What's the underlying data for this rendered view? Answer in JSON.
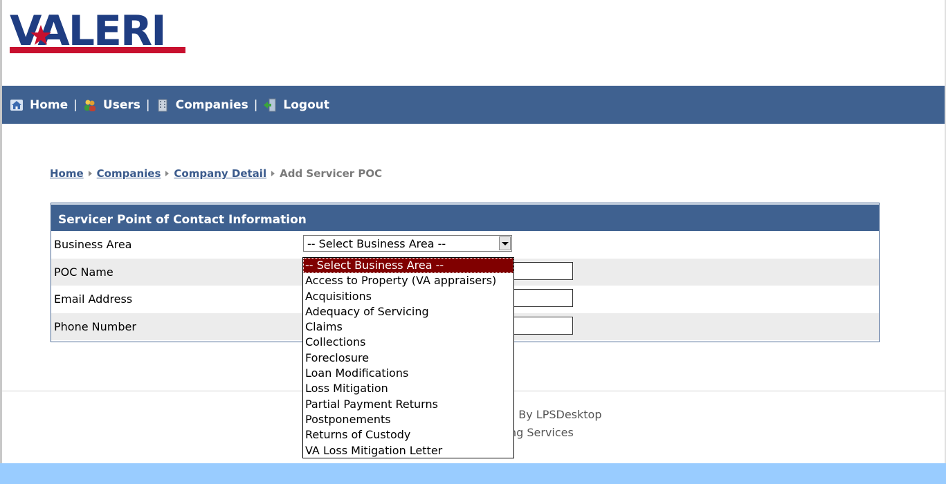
{
  "logo": {
    "text": "VALERI"
  },
  "nav": {
    "items": [
      {
        "label": "Home",
        "icon": "home-icon"
      },
      {
        "label": "Users",
        "icon": "users-icon"
      },
      {
        "label": "Companies",
        "icon": "building-icon"
      },
      {
        "label": "Logout",
        "icon": "logout-icon"
      }
    ],
    "separator": "|"
  },
  "breadcrumb": {
    "items": [
      "Home",
      "Companies",
      "Company Detail"
    ],
    "current": "Add Servicer POC"
  },
  "form": {
    "title": "Servicer Point of Contact Information",
    "fields": [
      {
        "label": "Business Area",
        "value": "-- Select Business Area --"
      },
      {
        "label": "POC Name",
        "value": ""
      },
      {
        "label": "Email Address",
        "value": ""
      },
      {
        "label": "Phone Number",
        "value": ""
      }
    ]
  },
  "dropdown": {
    "options": [
      "-- Select Business Area --",
      "Access to Property (VA appraisers)",
      "Acquisitions",
      "Adequacy of Servicing",
      "Claims",
      "Collections",
      "Foreclosure",
      "Loan Modifications",
      "Loss Mitigation",
      "Partial Payment Returns",
      "Postponements",
      "Returns of Custody",
      "VA Loss Mitigation Letter"
    ],
    "selected_index": 0
  },
  "footer": {
    "line1_partial": "d By LPSDesktop",
    "line2_partial": "ng Services"
  },
  "colors": {
    "nav_bg": "#3f6190",
    "link": "#3a5a8c",
    "selected_option": "#800000",
    "bottom_bar": "#99ccff"
  }
}
